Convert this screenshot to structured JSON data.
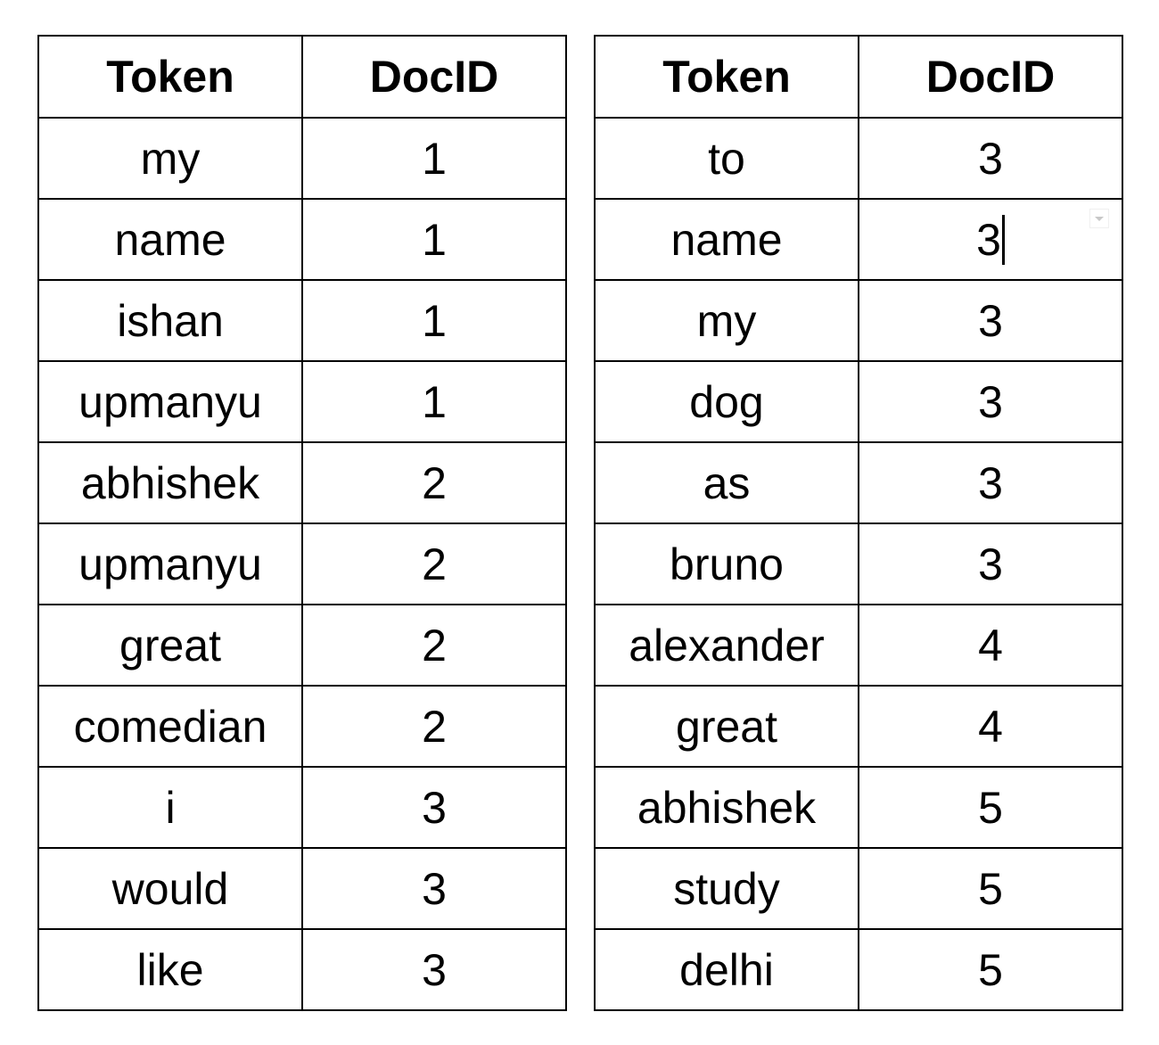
{
  "tables": [
    {
      "headers": [
        "Token",
        "DocID"
      ],
      "rows": [
        [
          "my",
          "1"
        ],
        [
          "name",
          "1"
        ],
        [
          "ishan",
          "1"
        ],
        [
          "upmanyu",
          "1"
        ],
        [
          "abhishek",
          "2"
        ],
        [
          "upmanyu",
          "2"
        ],
        [
          "great",
          "2"
        ],
        [
          "comedian",
          "2"
        ],
        [
          "i",
          "3"
        ],
        [
          "would",
          "3"
        ],
        [
          "like",
          "3"
        ]
      ]
    },
    {
      "headers": [
        "Token",
        "DocID"
      ],
      "rows": [
        [
          "to",
          "3"
        ],
        [
          "name",
          "3"
        ],
        [
          "my",
          "3"
        ],
        [
          "dog",
          "3"
        ],
        [
          "as",
          "3"
        ],
        [
          "bruno",
          "3"
        ],
        [
          "alexander",
          "4"
        ],
        [
          "great",
          "4"
        ],
        [
          "abhishek",
          "5"
        ],
        [
          "study",
          "5"
        ],
        [
          "delhi",
          "5"
        ]
      ]
    }
  ],
  "active_cell": {
    "table": 1,
    "row": 1,
    "column": 1,
    "editing": true
  }
}
